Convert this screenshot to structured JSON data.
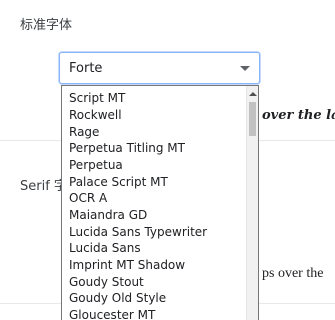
{
  "standard_font": {
    "label": "标准字体",
    "selected": "Forte",
    "preview_text": "over the la"
  },
  "serif_font": {
    "label": "Serif 字",
    "preview_text": "ps over the"
  },
  "dropdown": {
    "options": [
      "Script MT",
      "Rockwell",
      "Rage",
      "Perpetua Titling MT",
      "Perpetua",
      "Palace Script MT",
      "OCR A",
      "Maiandra GD",
      "Lucida Sans Typewriter",
      "Lucida Sans",
      "Imprint MT Shadow",
      "Goudy Stout",
      "Goudy Old Style",
      "Gloucester MT"
    ]
  }
}
